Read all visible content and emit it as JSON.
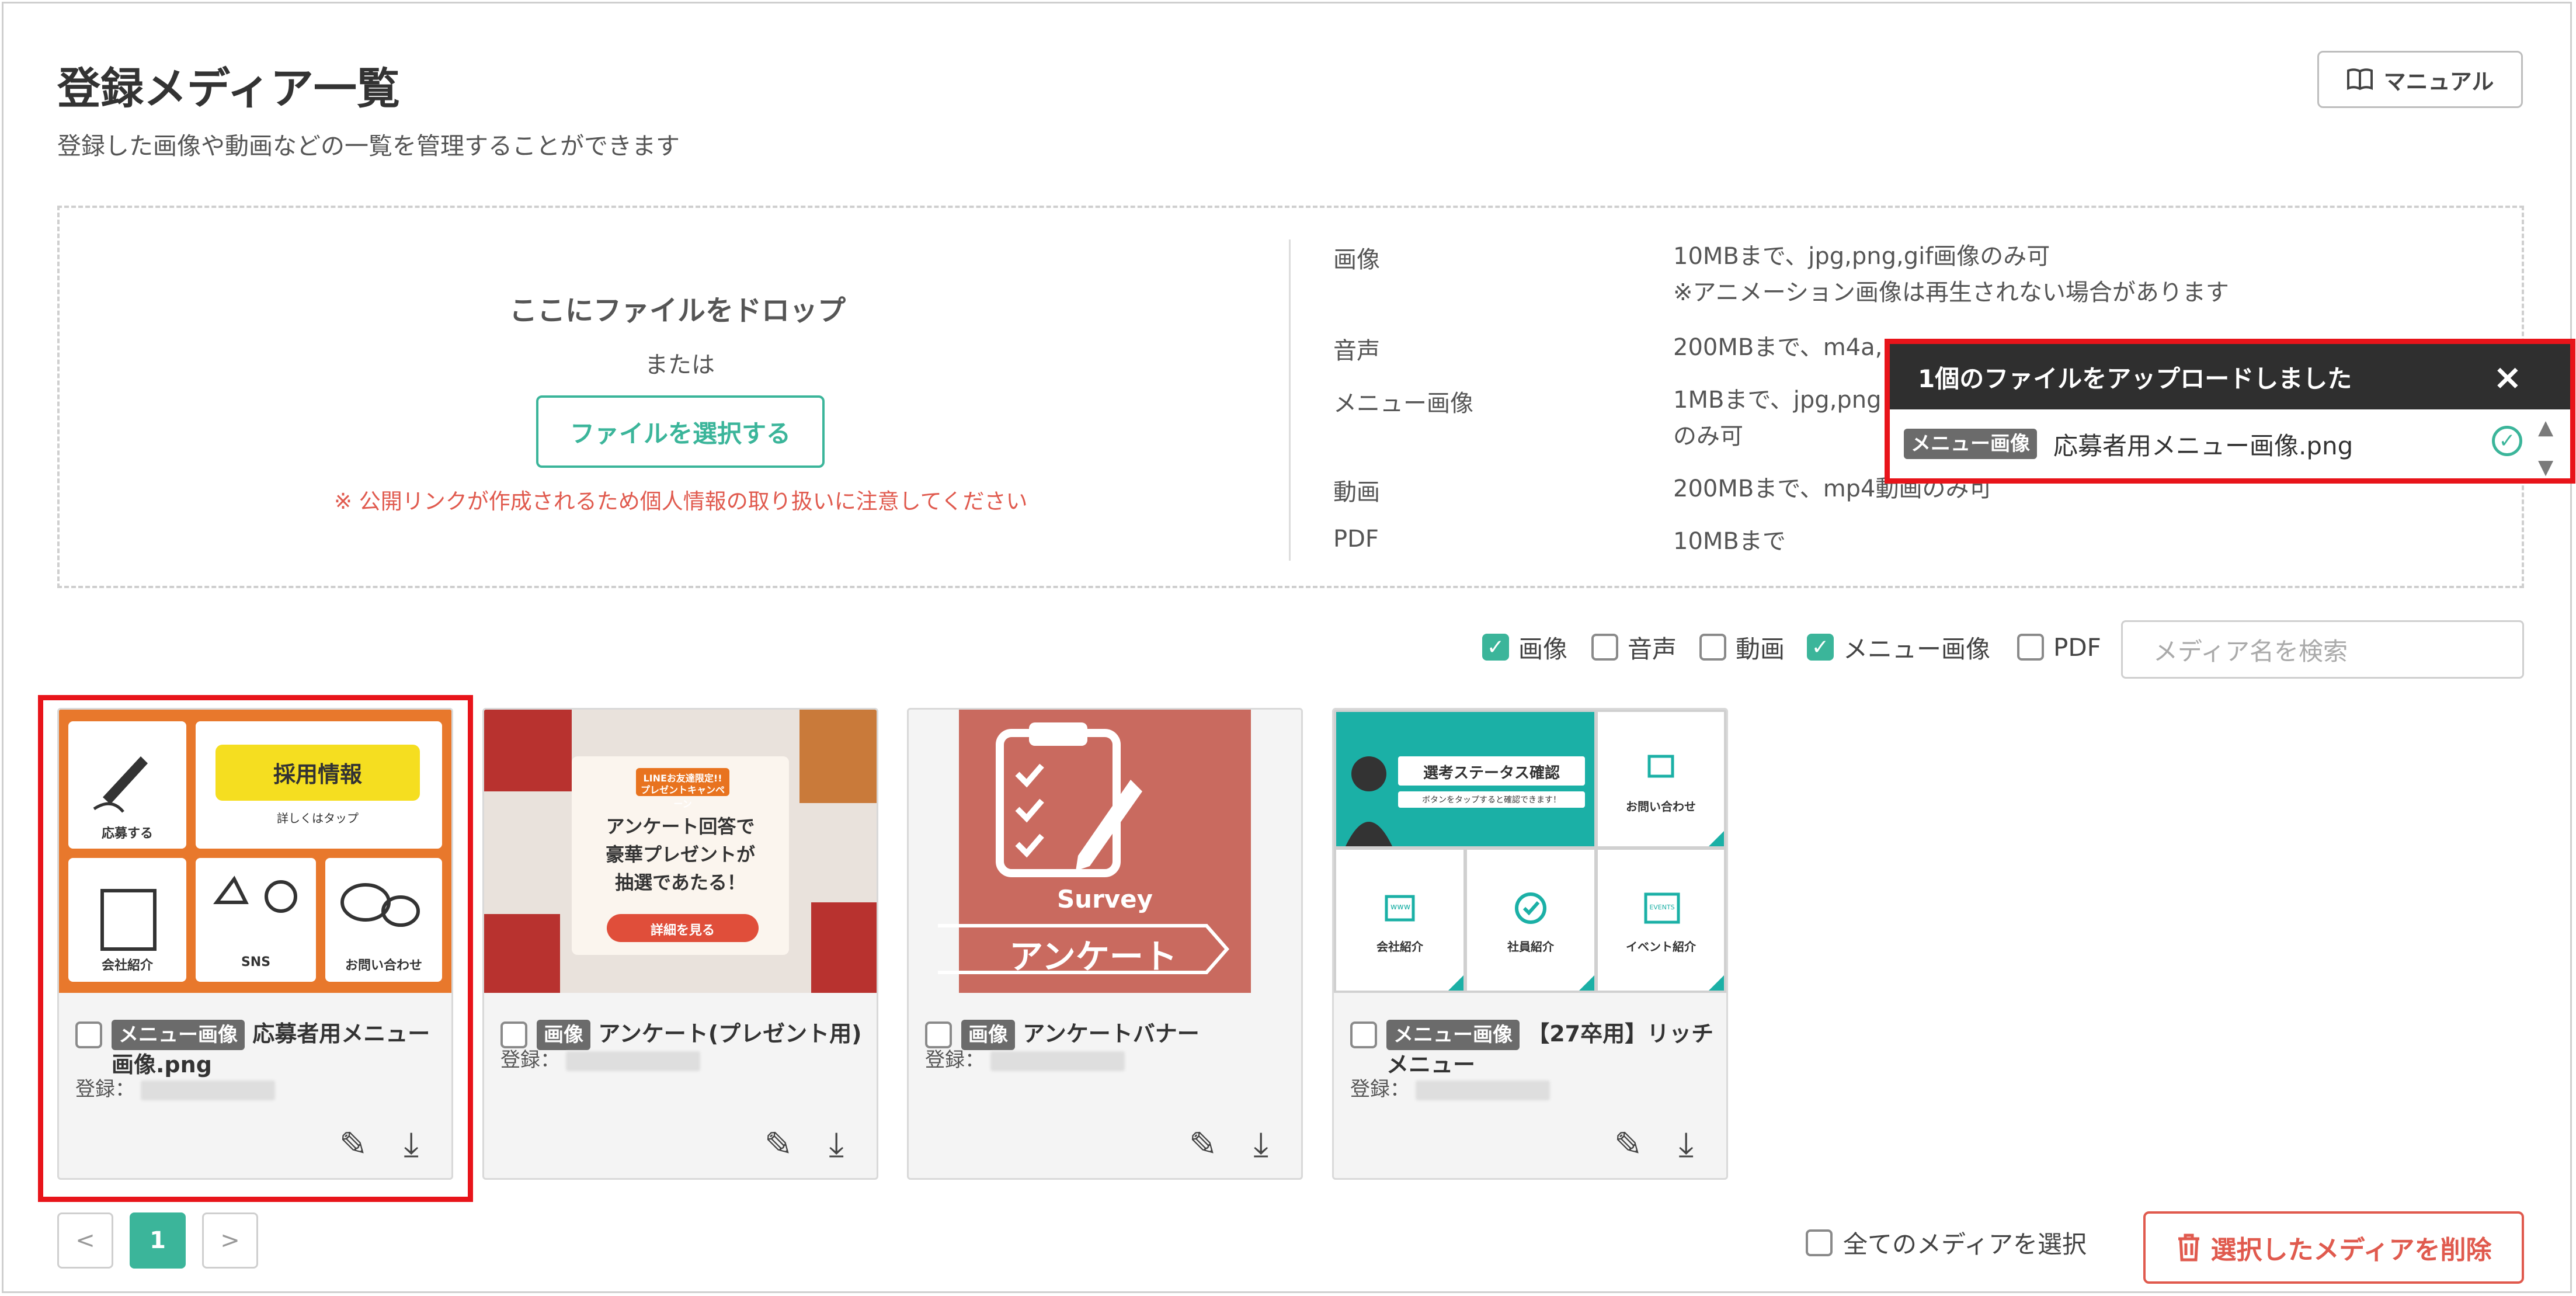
{
  "page": {
    "title": "登録メディア一覧",
    "subtitle": "登録した画像や動画などの一覧を管理することができます",
    "manual_label": "マニュアル"
  },
  "dropzone": {
    "title": "ここにファイルをドロップ",
    "or": "または",
    "select_button": "ファイルを選択する",
    "warning": "※ 公開リンクが作成されるため個人情報の取り扱いに注意してください"
  },
  "specs": [
    {
      "label": "画像",
      "value": "10MBまで、jpg,png,gif画像のみ可",
      "note": "※アニメーション画像は再生されない場合があります"
    },
    {
      "label": "音声",
      "value": "200MBまで、m4a,"
    },
    {
      "label": "メニュー画像",
      "value": "1MBまで、jpg,png",
      "note": "のみ可"
    },
    {
      "label": "動画",
      "value": "200MBまで、mp4動画のみ可"
    },
    {
      "label": "PDF",
      "value": "10MBまで"
    }
  ],
  "toast": {
    "message": "1個のファイルをアップロードしました",
    "close_icon": "×",
    "item_tag": "メニュー画像",
    "item_name": "応募者用メニュー画像.png",
    "status_icon": "✓"
  },
  "filters": [
    {
      "label": "画像",
      "checked": true
    },
    {
      "label": "音声",
      "checked": false
    },
    {
      "label": "動画",
      "checked": false
    },
    {
      "label": "メニュー画像",
      "checked": true
    },
    {
      "label": "PDF",
      "checked": false
    }
  ],
  "search": {
    "placeholder": "メディア名を検索"
  },
  "cards": [
    {
      "tag": "メニュー画像",
      "name": "応募者用メニュー画像.png",
      "registered": "登録："
    },
    {
      "tag": "画像",
      "name": "アンケート(プレゼント用)",
      "registered": "登録："
    },
    {
      "tag": "画像",
      "name": "アンケートバナー",
      "registered": "登録："
    },
    {
      "tag": "メニュー画像",
      "name": "【27卒用】リッチメニュー",
      "registered": "登録："
    }
  ],
  "thumb_text": {
    "menu1": {
      "recruit": "採用情報",
      "recruit_sub": "詳しくはタップ",
      "apply": "応募する",
      "company": "会社紹介",
      "sns": "SNS",
      "contact": "お問い合わせ"
    },
    "present": {
      "badge1": "LINEお友達限定!!",
      "badge2": "プレゼントキャンペーン",
      "line1": "アンケート回答で",
      "line2": "豪華プレゼントが",
      "line3": "抽選であたる！",
      "button": "詳細を見る"
    },
    "survey": {
      "en": "Survey",
      "jp": "アンケート"
    },
    "menu27": {
      "status": "選考ステータス確認",
      "status_sub": "ボタンをタップすると確認できます！",
      "contact": "お問い合わせ",
      "company": "会社紹介",
      "staff": "社員紹介",
      "event": "イベント紹介",
      "events_icon": "EVENTS",
      "www": "www"
    }
  },
  "pagination": {
    "prev": "<",
    "current": "1",
    "next": ">"
  },
  "footer": {
    "select_all": "全てのメディアを選択",
    "delete": "選択したメディアを削除"
  },
  "colors": {
    "accent": "#3bb59a",
    "danger": "#e05a4e",
    "highlight": "#e8141a"
  }
}
